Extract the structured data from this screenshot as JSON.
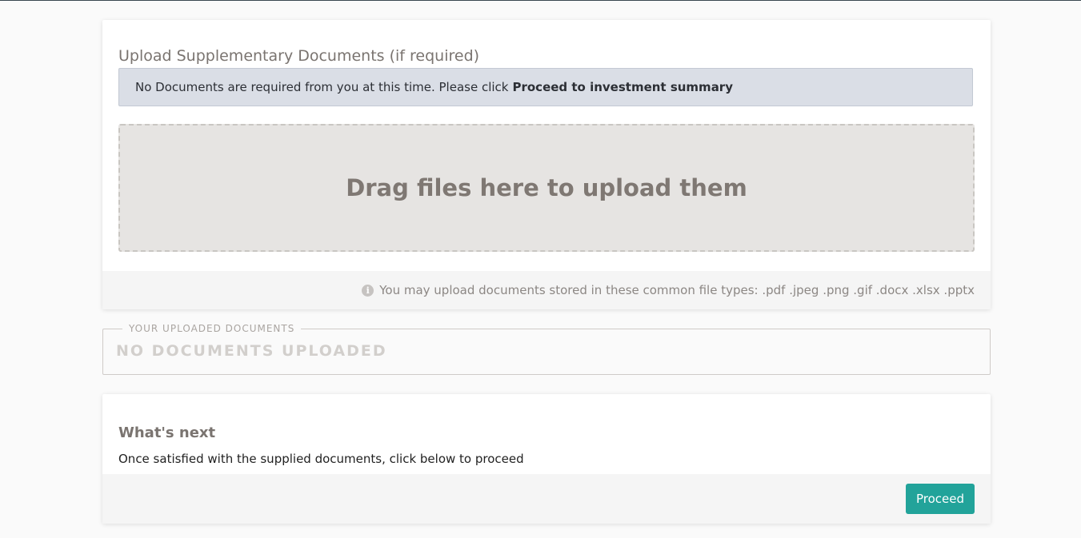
{
  "upload_section": {
    "title": "Upload Supplementary Documents (if required)",
    "alert_text": "No Documents are required from you at this time. Please click",
    "alert_bold": "Proceed to investment summary",
    "dropzone_text": "Drag files here to upload them",
    "hint_icon": "info-icon",
    "hint_text": "You may upload documents stored in these common file types: .pdf .jpeg .png .gif .docx .xlsx .pptx"
  },
  "uploaded_documents": {
    "legend": "YOUR UPLOADED DOCUMENTS",
    "empty_label": "NO DOCUMENTS UPLOADED"
  },
  "whats_next": {
    "title": "What's next",
    "body": "Once satisfied with the supplied documents, click below to proceed",
    "proceed_label": "Proceed"
  },
  "colors": {
    "accent": "#22a39a",
    "alert_bg": "#dadee6",
    "dropzone_bg": "#e6e4e2"
  }
}
